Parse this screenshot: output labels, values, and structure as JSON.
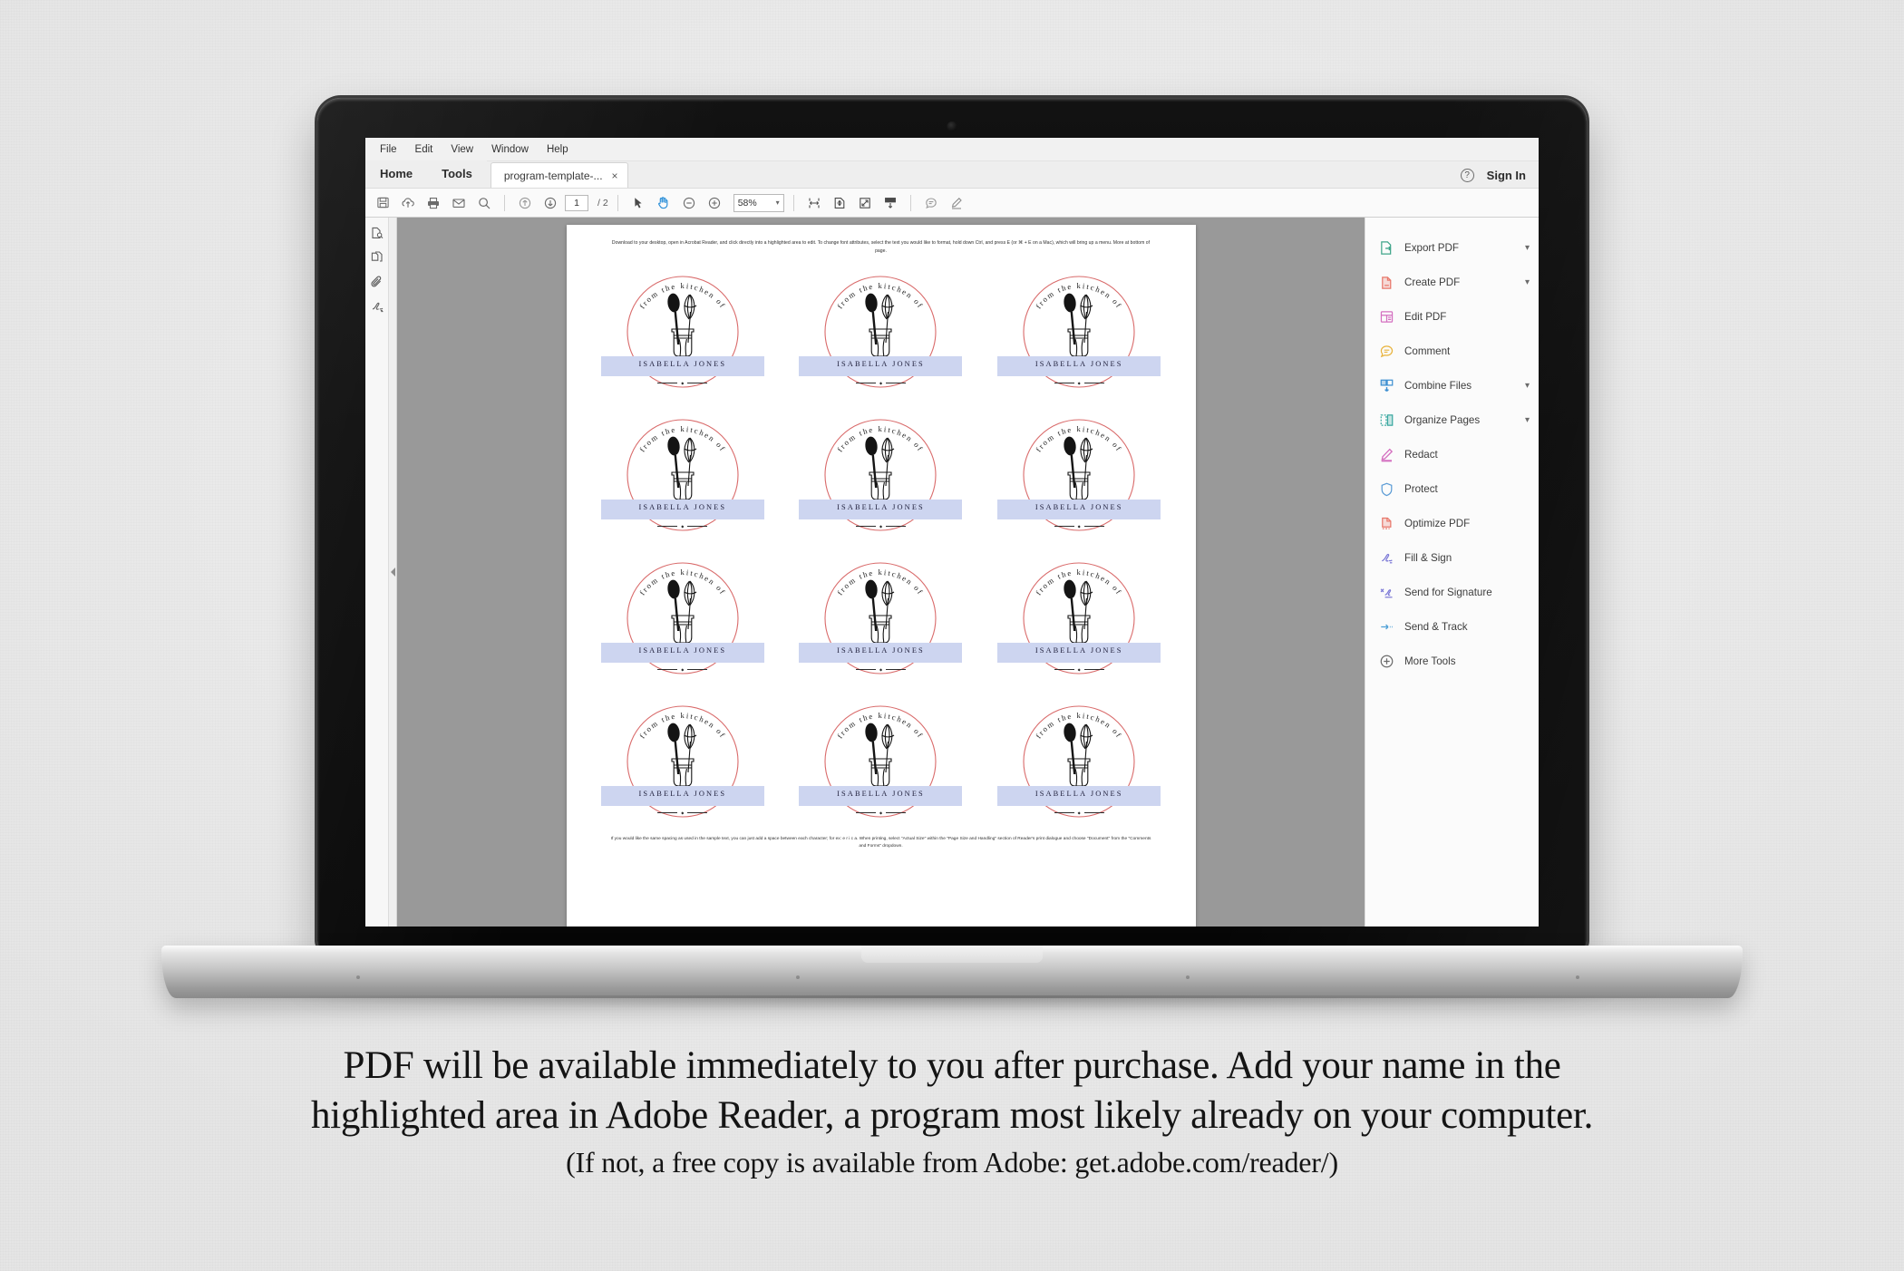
{
  "app": {
    "menubar": [
      "File",
      "Edit",
      "View",
      "Window",
      "Help"
    ],
    "tabs": {
      "home": "Home",
      "tools": "Tools",
      "document": "program-template-...",
      "close": "×"
    },
    "account": {
      "help_icon": "help-circle-icon",
      "sign_in": "Sign In"
    },
    "toolbar": {
      "icons": [
        "save-icon",
        "upload-cloud-icon",
        "print-icon",
        "email-icon",
        "search-icon"
      ],
      "nav_icons": [
        "previous-page-icon",
        "next-page-icon"
      ],
      "page_current": "1",
      "page_total": "/ 2",
      "tool_icons": [
        "select-tool-icon",
        "hand-tool-icon",
        "zoom-out-icon",
        "zoom-in-icon"
      ],
      "zoom_value": "58%",
      "zoom_caret": "▾",
      "view_icons": [
        "fit-width-icon",
        "fit-page-icon",
        "fullscreen-icon",
        "form-field-icon"
      ],
      "annot_icons": [
        "comment-icon",
        "highlight-icon"
      ]
    },
    "left_rail": [
      "page-thumbnails-icon",
      "pages-icon",
      "attachments-icon",
      "signatures-icon"
    ],
    "collapse": "collapse-panel-arrow"
  },
  "tools_panel": {
    "items": [
      {
        "label": "Export PDF",
        "icon": "export-pdf-icon",
        "color": "#3fa58a",
        "chevron": true
      },
      {
        "label": "Create PDF",
        "icon": "create-pdf-icon",
        "color": "#e8776a",
        "chevron": true
      },
      {
        "label": "Edit PDF",
        "icon": "edit-pdf-icon",
        "color": "#d46fc0",
        "chevron": false
      },
      {
        "label": "Comment",
        "icon": "comment-bubble-icon",
        "color": "#e8b33c",
        "chevron": false
      },
      {
        "label": "Combine Files",
        "icon": "combine-files-icon",
        "color": "#3d8fd1",
        "chevron": true
      },
      {
        "label": "Organize Pages",
        "icon": "organize-pages-icon",
        "color": "#3aa8a0",
        "chevron": true
      },
      {
        "label": "Redact",
        "icon": "redact-icon",
        "color": "#d46fc0",
        "chevron": false
      },
      {
        "label": "Protect",
        "icon": "shield-icon",
        "color": "#5b9bd5",
        "chevron": false
      },
      {
        "label": "Optimize PDF",
        "icon": "optimize-pdf-icon",
        "color": "#e8776a",
        "chevron": false
      },
      {
        "label": "Fill & Sign",
        "icon": "fill-sign-icon",
        "color": "#7b78d6",
        "chevron": false
      },
      {
        "label": "Send for Signature",
        "icon": "send-for-signature-icon",
        "color": "#7b78d6",
        "chevron": false
      },
      {
        "label": "Send & Track",
        "icon": "send-track-icon",
        "color": "#4d9fd6",
        "chevron": false
      },
      {
        "label": "More Tools",
        "icon": "plus-circle-icon",
        "color": "#6b6b6b",
        "chevron": false
      }
    ]
  },
  "document": {
    "header_note": "Download to your desktop, open in Acrobat Reader, and click directly into a highlighted area to edit. To change font attributes, select the text you would like to format, hold down Ctrl, and press E (or ⌘ + E on a Mac), which will bring up a menu.  More at bottom of page.",
    "footer_note": "If you would like the same spacing as used in the sample text, you can just add a space between each character; for ex: e r i c a.  When printing, select \"Actual Size\" within the \"Page Size and Handling\" section of Reader's print dialogue and choose \"Document\" from the \"Comments and Forms\" dropdown.",
    "label": {
      "arc_text": "from the kitchen of",
      "name": "ISABELLA JONES",
      "ring_color": "#d96a6a",
      "highlight_color": "#cdd5f0",
      "art": "mason-jar-with-spoon-and-whisk"
    },
    "label_count": 12
  },
  "caption": {
    "line1": "PDF will be available immediately to you after purchase.  Add your name in the",
    "line2": "highlighted area in Adobe Reader, a program most likely already on your computer.",
    "line3": "(If not, a free copy is available from Adobe: get.adobe.com/reader/)"
  }
}
